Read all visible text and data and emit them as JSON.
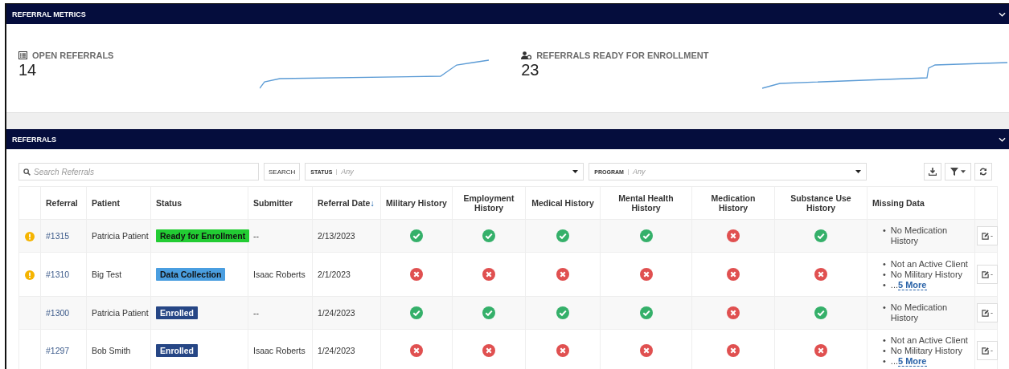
{
  "metrics_panel": {
    "title": "REFERRAL METRICS",
    "metrics": [
      {
        "kind": "list",
        "label": "OPEN REFERRALS",
        "value": "14"
      },
      {
        "kind": "user",
        "label": "REFERRALS READY FOR ENROLLMENT",
        "value": "23"
      }
    ]
  },
  "referrals_panel": {
    "title": "REFERRALS",
    "search": {
      "placeholder": "Search Referrals",
      "button": "SEARCH"
    },
    "filters": [
      {
        "label": "STATUS",
        "placeholder": "Any"
      },
      {
        "label": "PROGRAM",
        "placeholder": "Any"
      }
    ],
    "columns": [
      {
        "label": "Referral"
      },
      {
        "label": "Patient"
      },
      {
        "label": "Status"
      },
      {
        "label": "Submitter"
      },
      {
        "label": "Referral Date",
        "sort_arrow": "↓"
      },
      {
        "label": "Military History"
      },
      {
        "label": "Employment History"
      },
      {
        "label": "Medical History"
      },
      {
        "label": "Mental Health History"
      },
      {
        "label": "Medication History"
      },
      {
        "label": "Substance Use History"
      },
      {
        "label": "Missing Data"
      }
    ],
    "rows": [
      {
        "warning": true,
        "referral": "#1315",
        "patient": "Patricia Patient",
        "status": {
          "kind": "ready",
          "label": "Ready for Enrollment"
        },
        "submitter": "--",
        "date": "2/13/2023",
        "checks": [
          true,
          true,
          true,
          true,
          false,
          true
        ],
        "missing": [
          {
            "marker": "•",
            "text": "No Medication History"
          }
        ],
        "action": "-"
      },
      {
        "warning": true,
        "referral": "#1310",
        "patient": "Big Test",
        "status": {
          "kind": "collection",
          "label": "Data Collection"
        },
        "submitter": "Isaac Roberts",
        "date": "2/1/2023",
        "checks": [
          false,
          false,
          false,
          false,
          false,
          false
        ],
        "missing": [
          {
            "marker": "•",
            "text": "Not an Active Client"
          },
          {
            "marker": "•",
            "text": "No Military History"
          },
          {
            "marker": "•",
            "text": "...",
            "link": "5 More"
          }
        ],
        "action": "-"
      },
      {
        "warning": false,
        "referral": "#1300",
        "patient": "Patricia Patient",
        "status": {
          "kind": "enrolled",
          "label": "Enrolled"
        },
        "submitter": "--",
        "date": "1/24/2023",
        "checks": [
          true,
          true,
          true,
          true,
          false,
          true
        ],
        "missing": [
          {
            "marker": "•",
            "text": "No Medication History"
          }
        ],
        "action": "-"
      },
      {
        "warning": false,
        "referral": "#1297",
        "patient": "Bob Smith",
        "status": {
          "kind": "enrolled",
          "label": "Enrolled"
        },
        "submitter": "Isaac Roberts",
        "date": "1/24/2023",
        "checks": [
          false,
          false,
          false,
          false,
          false,
          false
        ],
        "missing": [
          {
            "marker": "•",
            "text": "Not an Active Client"
          },
          {
            "marker": "•",
            "text": "No Military History"
          },
          {
            "marker": "•",
            "text": "...",
            "link": "5 More"
          }
        ],
        "action": "-"
      }
    ]
  }
}
